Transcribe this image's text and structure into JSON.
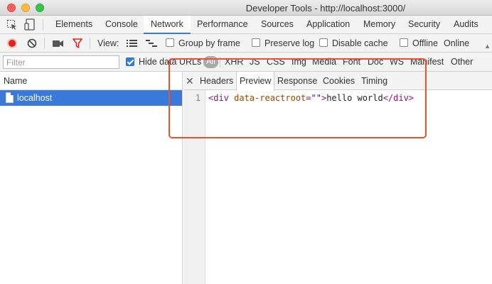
{
  "window": {
    "title": "Developer Tools - http://localhost:3000/"
  },
  "main_tabs": [
    {
      "label": "Elements"
    },
    {
      "label": "Console"
    },
    {
      "label": "Network",
      "active": true
    },
    {
      "label": "Performance"
    },
    {
      "label": "Sources"
    },
    {
      "label": "Application"
    },
    {
      "label": "Memory"
    },
    {
      "label": "Security"
    },
    {
      "label": "Audits"
    }
  ],
  "toolbar": {
    "view_label": "View:",
    "group_by_frame": {
      "label": "Group by frame",
      "checked": false
    },
    "preserve_log": {
      "label": "Preserve log",
      "checked": false
    },
    "disable_cache": {
      "label": "Disable cache",
      "checked": false
    },
    "offline": {
      "label": "Offline",
      "checked": false
    },
    "throttle": "Online"
  },
  "filterbar": {
    "placeholder": "Filter",
    "hide_data_urls": {
      "label": "Hide data URLs",
      "checked": true
    },
    "types": [
      "All",
      "XHR",
      "JS",
      "CSS",
      "Img",
      "Media",
      "Font",
      "Doc",
      "WS",
      "Manifest",
      "Other"
    ]
  },
  "request_list": {
    "header": "Name",
    "rows": [
      {
        "name": "localhost",
        "selected": true
      }
    ]
  },
  "detail": {
    "tabs": [
      {
        "label": "Headers"
      },
      {
        "label": "Preview",
        "active": true
      },
      {
        "label": "Response"
      },
      {
        "label": "Cookies"
      },
      {
        "label": "Timing"
      }
    ],
    "line_number": "1",
    "code": {
      "open_tag": "<div",
      "attr": " data-reactroot",
      "eq": "=",
      "val": "\"\"",
      "close_open": ">",
      "text": "hello world",
      "end_tag": "</div>"
    }
  },
  "colors": {
    "accent": "#3879d9",
    "highlight": "#e8532a",
    "record": "#e0241b",
    "filter_icon": "#e0241b"
  }
}
